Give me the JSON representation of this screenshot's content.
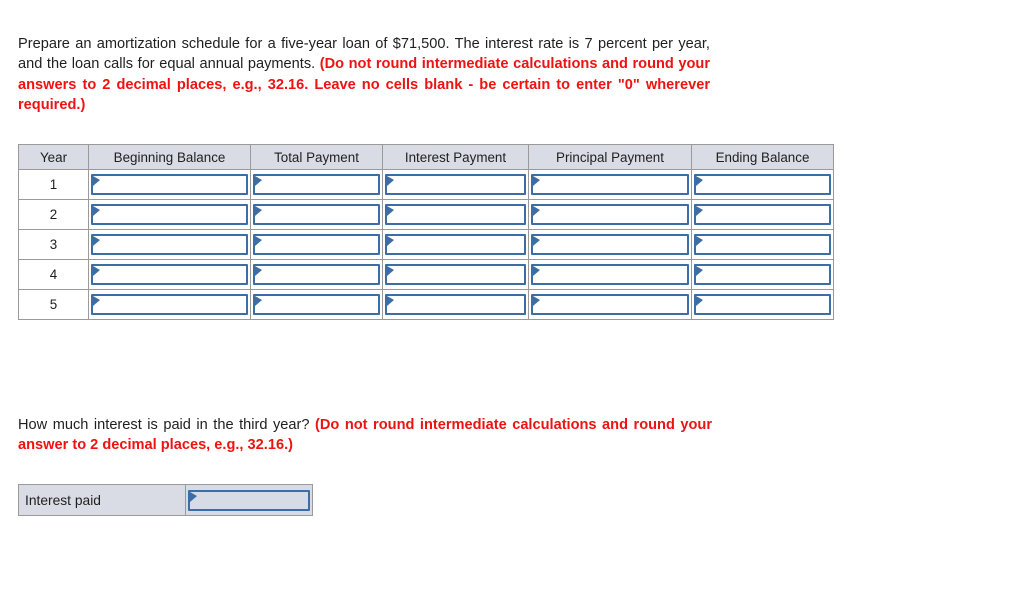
{
  "question_1": {
    "text_plain_1": "Prepare an amortization schedule for a five-year loan of $71,500. The interest rate is 7 percent per year, and the loan calls for equal annual payments. ",
    "text_emph_1": "(Do not round intermediate calculations and round your answers to 2 decimal places, e.g., 32.16. Leave no cells blank - be certain to enter \"0\" wherever required.)"
  },
  "question_2": {
    "text_plain_1": "How much interest is paid in the third year? ",
    "text_emph_1": "(Do not round intermediate calculations and round your answer to 2 decimal places, e.g., 32.16.)"
  },
  "schedule_table": {
    "headers": [
      "Year",
      "Beginning Balance",
      "Total Payment",
      "Interest Payment",
      "Principal Payment",
      "Ending Balance"
    ],
    "rows": [
      {
        "year": "1",
        "beginning_balance": "",
        "total_payment": "",
        "interest_payment": "",
        "principal_payment": "",
        "ending_balance": ""
      },
      {
        "year": "2",
        "beginning_balance": "",
        "total_payment": "",
        "interest_payment": "",
        "principal_payment": "",
        "ending_balance": ""
      },
      {
        "year": "3",
        "beginning_balance": "",
        "total_payment": "",
        "interest_payment": "",
        "principal_payment": "",
        "ending_balance": ""
      },
      {
        "year": "4",
        "beginning_balance": "",
        "total_payment": "",
        "interest_payment": "",
        "principal_payment": "",
        "ending_balance": ""
      },
      {
        "year": "5",
        "beginning_balance": "",
        "total_payment": "",
        "interest_payment": "",
        "principal_payment": "",
        "ending_balance": ""
      }
    ]
  },
  "interest_paid_row": {
    "label": "Interest paid",
    "value": ""
  },
  "colors": {
    "header_fill": "#d9dce5",
    "entry_border": "#3c6ea5",
    "emphasis_text": "#ee1212",
    "grid_line": "#9a9a9a",
    "interest_entry_fill": "#d6dbe6"
  }
}
